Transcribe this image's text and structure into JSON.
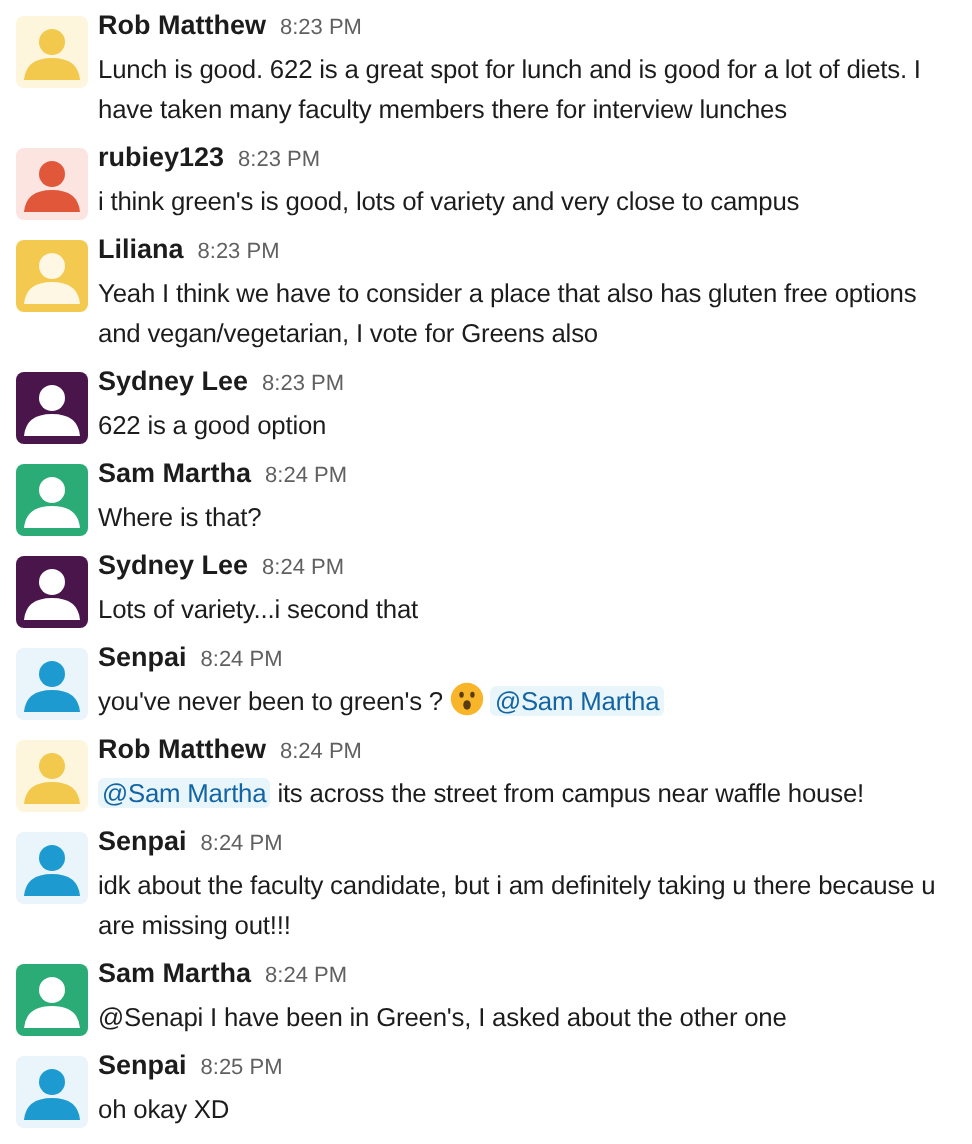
{
  "messages": [
    {
      "author": "Rob Matthew",
      "time": "8:23 PM",
      "avatar": {
        "figure": {
          "color": "#f2c94c"
        },
        "tile": {
          "color": "#fdf5dc"
        }
      },
      "parts": [
        {
          "kind": "text",
          "text": "Lunch is good. 622 is a great spot for lunch and is good for a lot of diets. I have taken many faculty members there for interview lunches"
        }
      ]
    },
    {
      "author": "rubiey123",
      "time": "8:23 PM",
      "avatar": {
        "figure": {
          "color": "#e0573a"
        },
        "tile": {
          "color": "#fce4e0"
        }
      },
      "parts": [
        {
          "kind": "text",
          "text": "i think green's is good, lots of variety and very close to campus"
        }
      ]
    },
    {
      "author": "Liliana",
      "time": "8:23 PM",
      "avatar": {
        "figure": {
          "color": "#fdf7e4"
        },
        "tile": {
          "color": "#f4c94f"
        }
      },
      "parts": [
        {
          "kind": "text",
          "text": "Yeah I think we have to consider a place that also has gluten free options and vegan/vegetarian, I vote for Greens also"
        }
      ]
    },
    {
      "author": "Sydney Lee",
      "time": "8:23 PM",
      "avatar": {
        "figure": {
          "color": "#ffffff"
        },
        "tile": {
          "color": "#4a154b"
        }
      },
      "parts": [
        {
          "kind": "text",
          "text": "622 is a good option"
        }
      ]
    },
    {
      "author": "Sam Martha",
      "time": "8:24 PM",
      "avatar": {
        "figure": {
          "color": "#ffffff"
        },
        "tile": {
          "color": "#2bac76"
        }
      },
      "parts": [
        {
          "kind": "text",
          "text": "Where is that?"
        }
      ]
    },
    {
      "author": "Sydney Lee",
      "time": "8:24 PM",
      "avatar": {
        "figure": {
          "color": "#ffffff"
        },
        "tile": {
          "color": "#4a154b"
        }
      },
      "parts": [
        {
          "kind": "text",
          "text": "Lots of variety...i second that"
        }
      ]
    },
    {
      "author": "Senpai",
      "time": "8:24 PM",
      "avatar": {
        "figure": {
          "color": "#1d9bd1"
        },
        "tile": {
          "color": "#eaf5fb"
        }
      },
      "parts": [
        {
          "kind": "text",
          "text": "you've never been to green's ?"
        },
        {
          "kind": "emoji"
        },
        {
          "kind": "mention",
          "text": "@Sam Martha"
        }
      ]
    },
    {
      "author": "Rob Matthew",
      "time": "8:24 PM",
      "avatar": {
        "figure": {
          "color": "#f2c94c"
        },
        "tile": {
          "color": "#fdf5dc"
        }
      },
      "parts": [
        {
          "kind": "mention",
          "text": "@Sam Martha"
        },
        {
          "kind": "text",
          "text": "its across the street from campus near waffle house!"
        }
      ]
    },
    {
      "author": "Senpai",
      "time": "8:24 PM",
      "avatar": {
        "figure": {
          "color": "#1d9bd1"
        },
        "tile": {
          "color": "#eaf5fb"
        }
      },
      "parts": [
        {
          "kind": "text",
          "text": "idk about the faculty candidate, but i am definitely taking u there because u are missing out!!!"
        }
      ]
    },
    {
      "author": "Sam Martha",
      "time": "8:24 PM",
      "avatar": {
        "figure": {
          "color": "#ffffff"
        },
        "tile": {
          "color": "#2bac76"
        }
      },
      "parts": [
        {
          "kind": "text",
          "text": "@Senapi I have been in Green's, I asked about the other one"
        }
      ]
    },
    {
      "author": "Senpai",
      "time": "8:25 PM",
      "avatar": {
        "figure": {
          "color": "#1d9bd1"
        },
        "tile": {
          "color": "#eaf5fb"
        }
      },
      "parts": [
        {
          "kind": "text",
          "text": "oh okay XD"
        }
      ]
    }
  ]
}
